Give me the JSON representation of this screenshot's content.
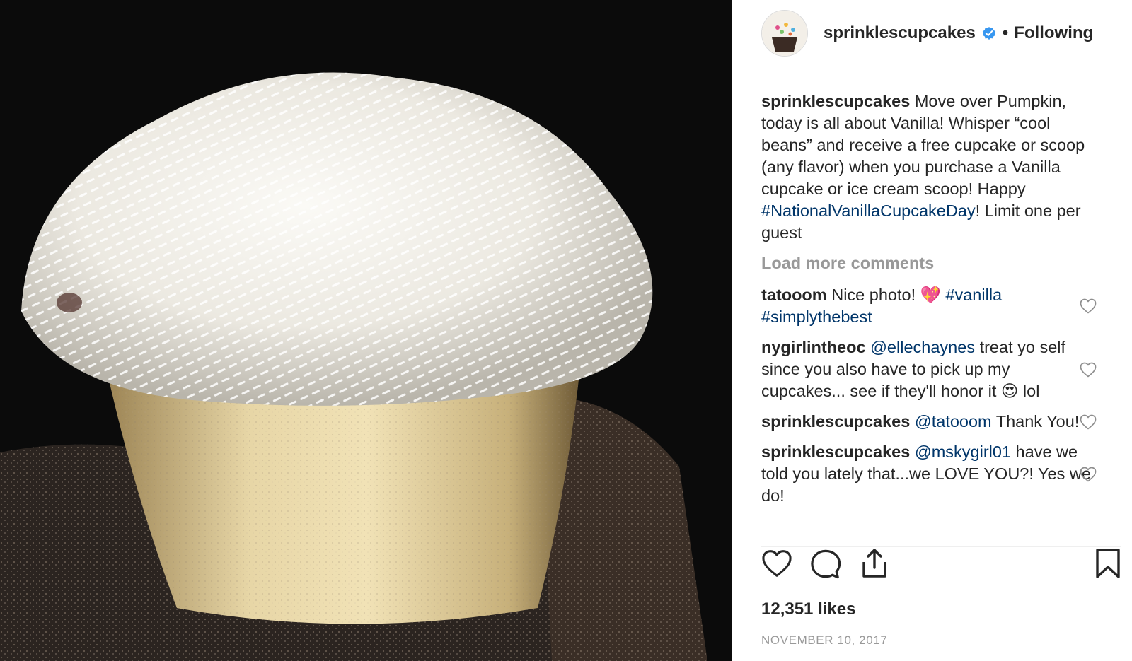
{
  "post": {
    "author": "sprinklescupcakes",
    "follow_status": "Following",
    "separator": "•",
    "caption": {
      "username": "sprinklescupcakes",
      "text_before": "Move over Pumpkin, today is all about Vanilla! Whisper “cool beans” and receive a free cupcake or scoop (any flavor) when you purchase a Vanilla cupcake or ice cream scoop! Happy ",
      "hashtag": "#NationalVanillaCupcakeDay",
      "text_after": "! Limit one per guest"
    },
    "load_more_label": "Load more comments",
    "comments": [
      {
        "username": "tatooom",
        "parts": [
          {
            "type": "text",
            "value": "Nice photo! "
          },
          {
            "type": "emoji",
            "value": "💖"
          },
          {
            "type": "text",
            "value": " "
          },
          {
            "type": "tag",
            "value": "#vanilla"
          },
          {
            "type": "text",
            "value": " "
          },
          {
            "type": "tag",
            "value": "#simplythebest"
          }
        ]
      },
      {
        "username": "nygirlintheoc",
        "parts": [
          {
            "type": "tag",
            "value": "@ellechaynes"
          },
          {
            "type": "text",
            "value": " treat yo self since you also have to pick up my cupcakes... see if they'll honor it "
          },
          {
            "type": "emoji",
            "value": "😍"
          },
          {
            "type": "text",
            "value": " lol"
          }
        ]
      },
      {
        "username": "sprinklescupcakes",
        "parts": [
          {
            "type": "tag",
            "value": "@tatooom"
          },
          {
            "type": "text",
            "value": " Thank You!"
          }
        ]
      },
      {
        "username": "sprinklescupcakes",
        "parts": [
          {
            "type": "tag",
            "value": "@mskygirl01"
          },
          {
            "type": "text",
            "value": " have we told you lately that...we LOVE YOU?! Yes we do!"
          }
        ]
      }
    ],
    "likes_label": "12,351 likes",
    "date": "NOVEMBER 10, 2017",
    "icons": {
      "like": "heart-icon",
      "comment": "comment-bubble-icon",
      "share": "share-icon",
      "save": "bookmark-icon",
      "comment_like": "small-heart-icon",
      "verified": "verified-badge-icon"
    },
    "colors": {
      "link": "#003569",
      "muted": "#999999",
      "verified": "#3897f0",
      "text": "#262626"
    }
  }
}
